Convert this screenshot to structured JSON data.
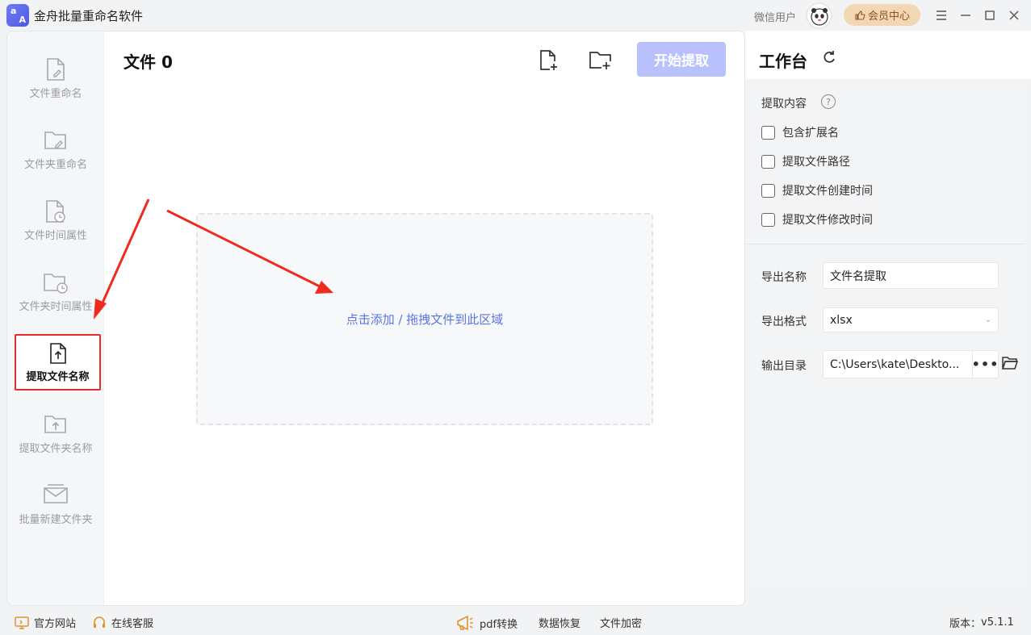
{
  "app": {
    "title": "金舟批量重命名软件",
    "logo_top": "a",
    "logo_bottom": "A",
    "user_label": "微信用户",
    "vip_label": "会员中心",
    "accent": "#5a74e0",
    "start_button_color": "#b8c1fb"
  },
  "sidebar": {
    "items": [
      {
        "label": "文件重命名",
        "icon": "file-edit-icon"
      },
      {
        "label": "文件夹重命名",
        "icon": "folder-edit-icon"
      },
      {
        "label": "文件时间属性",
        "icon": "file-clock-icon"
      },
      {
        "label": "文件夹时间属性",
        "icon": "folder-clock-icon"
      },
      {
        "label": "提取文件名称",
        "icon": "file-upload-icon",
        "active": true
      },
      {
        "label": "提取文件夹名称",
        "icon": "folder-upload-icon"
      },
      {
        "label": "批量新建文件夹",
        "icon": "folder-new-icon"
      }
    ]
  },
  "main": {
    "files_title": "文件 0",
    "start_button": "开始提取",
    "dropzone_text": "点击添加 / 拖拽文件到此区域"
  },
  "workbench": {
    "title": "工作台",
    "extract_label": "提取内容",
    "help": "?",
    "options": [
      {
        "label": "包含扩展名",
        "checked": false
      },
      {
        "label": "提取文件路径",
        "checked": false
      },
      {
        "label": "提取文件创建时间",
        "checked": false
      },
      {
        "label": "提取文件修改时间",
        "checked": false
      }
    ],
    "export_name_label": "导出名称",
    "export_name_value": "文件名提取",
    "export_format_label": "导出格式",
    "export_format_value": "xlsx",
    "output_dir_label": "输出目录",
    "output_dir_value": "C:\\Users\\kate\\Deskto...",
    "more": "•••"
  },
  "footer": {
    "website": "官方网站",
    "support": "在线客服",
    "pdf": "pdf转换",
    "recovery": "数据恢复",
    "encrypt": "文件加密",
    "version_label": "版本：",
    "version": "v5.1.1"
  }
}
